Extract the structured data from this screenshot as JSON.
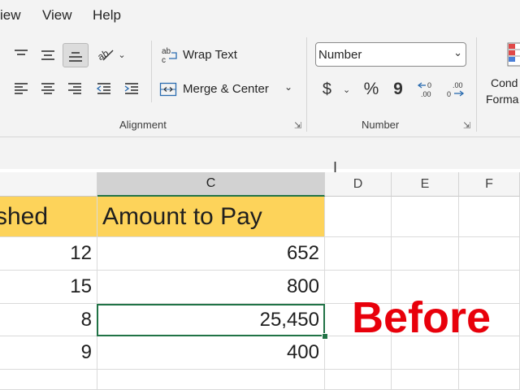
{
  "menu": [
    "iew",
    "View",
    "Help"
  ],
  "ribbon": {
    "alignment": {
      "wrap_text": "Wrap Text",
      "merge_center": "Merge & Center",
      "group_label": "Alignment"
    },
    "number": {
      "format_value": "Number",
      "currency_symbol": "$",
      "percent_symbol": "%",
      "comma_symbol": "9",
      "group_label": "Number"
    },
    "styles": {
      "cond_line1": "Cond",
      "cond_line2": "Forma"
    }
  },
  "grid": {
    "columns": [
      "C",
      "D",
      "E",
      "F"
    ],
    "header_row": {
      "b": "shed",
      "c": "Amount to Pay"
    },
    "rows": [
      {
        "b": "12",
        "c": "652"
      },
      {
        "b": "15",
        "c": "800"
      },
      {
        "b": "8",
        "c": "25,450"
      },
      {
        "b": "9",
        "c": "400"
      }
    ],
    "active_cell_value": "25,450"
  },
  "overlay": {
    "label": "Before",
    "color": "#e8000b"
  },
  "colors": {
    "header_fill": "#fdd35a",
    "selection": "#217346"
  }
}
